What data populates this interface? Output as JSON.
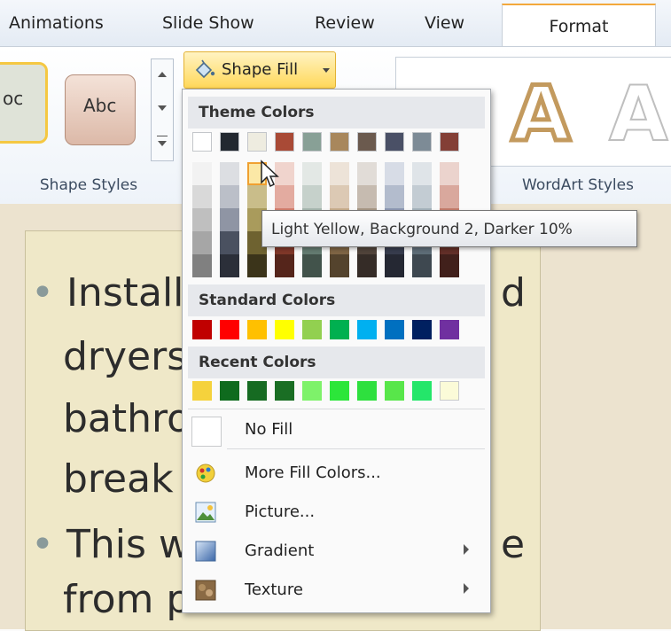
{
  "tabs": [
    "Animations",
    "Slide Show",
    "Review",
    "View",
    "Format"
  ],
  "active_tab": "Format",
  "shape_fill_label": "Shape Fill",
  "shape_style_sample": "Abc",
  "shape_style_sample_left": "oc",
  "wordart_sample": "A",
  "group_labels": {
    "shape_styles": "Shape Styles",
    "wordart_styles": "WordArt Styles"
  },
  "menu": {
    "theme_header": "Theme Colors",
    "standard_header": "Standard Colors",
    "recent_header": "Recent Colors",
    "no_fill": "No Fill",
    "more_colors": "More Fill Colors...",
    "picture": "Picture...",
    "gradient": "Gradient",
    "texture": "Texture"
  },
  "theme_top": [
    "#ffffff",
    "#222830",
    "#eeece0",
    "#a94a36",
    "#88a096",
    "#a8875c",
    "#6b5a4e",
    "#4a5066",
    "#7d8b96",
    "#833f36"
  ],
  "theme_shades": [
    [
      "#f2f2f2",
      "#dcdee2",
      "#ddd6b8",
      "#f0d4cd",
      "#e3e8e5",
      "#ede3d8",
      "#e1dcd7",
      "#d7dce6",
      "#dfe4e8",
      "#ebd3cd"
    ],
    [
      "#d9d9d9",
      "#bbbfc8",
      "#c9bd8a",
      "#e3aba0",
      "#c6d1cb",
      "#dcc9b4",
      "#c6bbb0",
      "#b3bccd",
      "#c3ccd3",
      "#d9a89d"
    ],
    [
      "#bfbfbf",
      "#8f95a4",
      "#a99b5c",
      "#d4806f",
      "#a9b9b0",
      "#caae8e",
      "#a99987",
      "#8f9ab4",
      "#a7b4bd",
      "#c67d6d"
    ],
    [
      "#a6a6a6",
      "#4a5160",
      "#6e6230",
      "#7f3729",
      "#637b70",
      "#7e6444",
      "#50433a",
      "#373c4d",
      "#5d6c77",
      "#622f28"
    ],
    [
      "#808080",
      "#2b2f39",
      "#3b341a",
      "#55251b",
      "#42534b",
      "#54432d",
      "#352c27",
      "#252833",
      "#3e4850",
      "#41201b"
    ]
  ],
  "standard": [
    "#c00000",
    "#ff0000",
    "#ffc000",
    "#ffff00",
    "#92d050",
    "#00b050",
    "#00b0f0",
    "#0070c0",
    "#002060",
    "#7030a0"
  ],
  "recent": [
    "#f5d23c",
    "#0f6b1e",
    "#166b22",
    "#1a6e24",
    "#7ef26a",
    "#2ce63a",
    "#2ee03e",
    "#58e64a",
    "#24e66a",
    "#fbfbd8"
  ],
  "tooltip": "Light Yellow, Background 2, Darker 10%",
  "slide_text": {
    "line1": "Install",
    "line1_end": "d",
    "line2": "dryers",
    "line3": "bathro",
    "line4": "break",
    "line5": "This w",
    "line5_end": "e",
    "line6": "from p"
  }
}
